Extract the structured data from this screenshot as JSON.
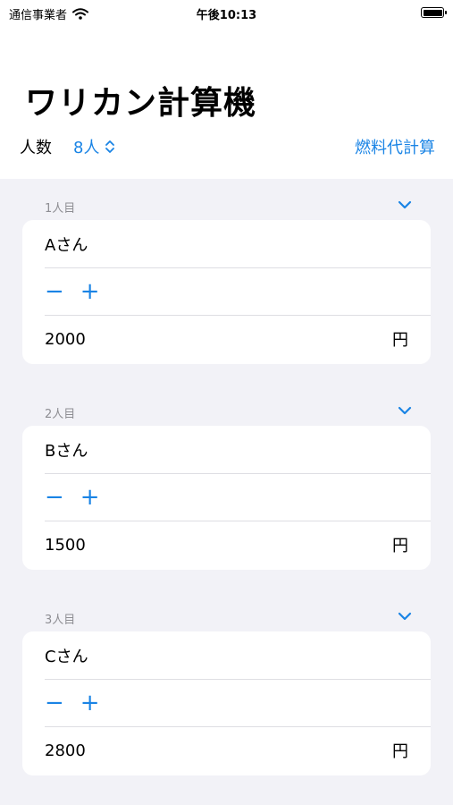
{
  "status_bar": {
    "carrier": "通信事業者",
    "time": "午後10:13"
  },
  "header": {
    "title": "ワリカン計算機",
    "people_label": "人数",
    "people_value": "8人",
    "fuel_link": "燃料代計算"
  },
  "persons": [
    {
      "label": "1人目",
      "name": "Aさん",
      "minus": "−",
      "plus": "+",
      "amount": "2000",
      "unit": "円"
    },
    {
      "label": "2人目",
      "name": "Bさん",
      "minus": "−",
      "plus": "+",
      "amount": "1500",
      "unit": "円"
    },
    {
      "label": "3人目",
      "name": "Cさん",
      "minus": "−",
      "plus": "+",
      "amount": "2800",
      "unit": "円"
    }
  ],
  "colors": {
    "accent": "#1a84e5",
    "background": "#f2f2f7",
    "secondary_text": "#8e8e93"
  },
  "icons": [
    "wifi-icon",
    "battery-icon",
    "chevron-up-down-icon",
    "chevron-down-icon"
  ]
}
